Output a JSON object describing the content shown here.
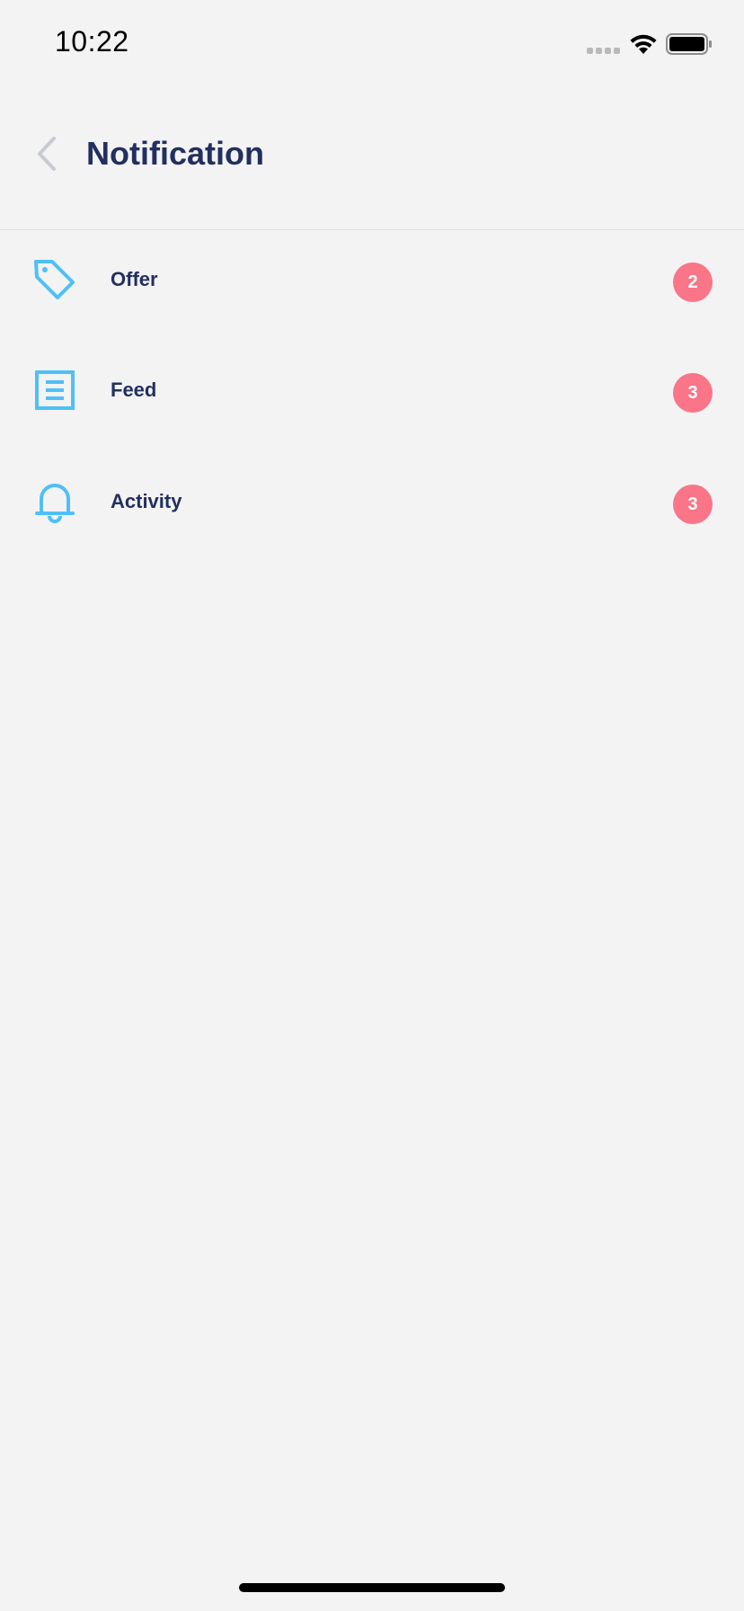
{
  "status_bar": {
    "time": "10:22"
  },
  "header": {
    "title": "Notification",
    "back_icon": "chevron-left-icon"
  },
  "colors": {
    "background": "#f3f3f4",
    "title": "#22305f",
    "accent_icon": "#4fc0f6",
    "badge": "#f97587",
    "divider": "#d9e3f3"
  },
  "items": [
    {
      "label": "Offer",
      "icon": "tag-icon",
      "count": "2"
    },
    {
      "label": "Feed",
      "icon": "document-icon",
      "count": "3"
    },
    {
      "label": "Activity",
      "icon": "bell-icon",
      "count": "3"
    }
  ]
}
